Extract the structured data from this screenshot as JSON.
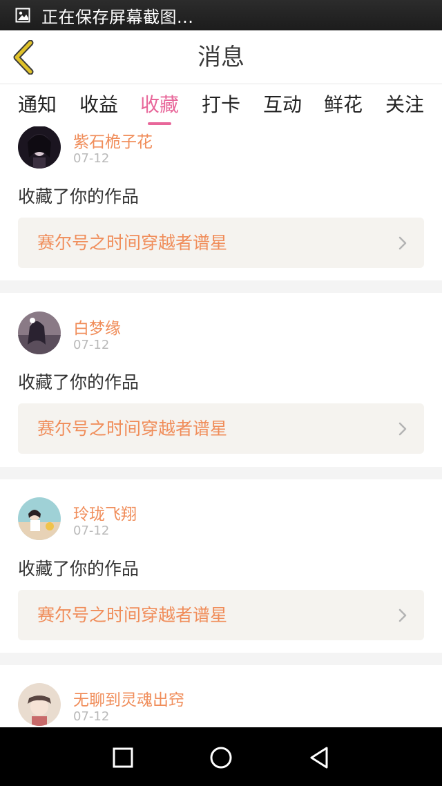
{
  "status_bar": {
    "text": "正在保存屏幕截图...",
    "icon": "screenshot-icon"
  },
  "header": {
    "title": "消息",
    "back_icon": "chevron-left-icon"
  },
  "tabs": [
    {
      "label": "通知"
    },
    {
      "label": "收益"
    },
    {
      "label": "收藏",
      "active": true
    },
    {
      "label": "打卡"
    },
    {
      "label": "互动"
    },
    {
      "label": "鲜花"
    },
    {
      "label": "关注"
    }
  ],
  "feed": [
    {
      "user": "紫石桅子花",
      "date": "07-12",
      "action": "收藏了你的作品",
      "work": "赛尔号之时间穿越者谱星"
    },
    {
      "user": "白梦缘",
      "date": "07-12",
      "action": "收藏了你的作品",
      "work": "赛尔号之时间穿越者谱星"
    },
    {
      "user": "玲珑飞翔",
      "date": "07-12",
      "action": "收藏了你的作品",
      "work": "赛尔号之时间穿越者谱星"
    },
    {
      "user": "无聊到灵魂出窍",
      "date": "07-12"
    }
  ],
  "nav_bar": {
    "recent": "square-icon",
    "home": "circle-icon",
    "back": "triangle-back-icon"
  },
  "colors": {
    "accent": "#e8679a",
    "orange_text": "#f08d5a",
    "back_icon": "#e0c22a"
  }
}
